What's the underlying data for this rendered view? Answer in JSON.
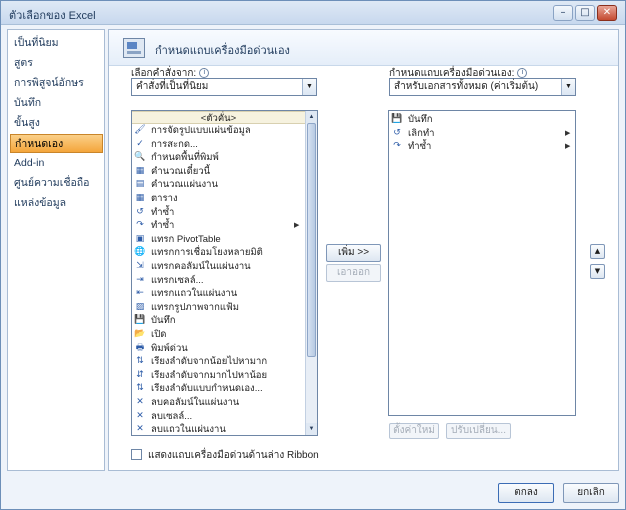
{
  "window": {
    "title": "ตัวเลือกของ Excel",
    "min_symbol": "–",
    "max_symbol": "□",
    "close_symbol": "✕"
  },
  "sidebar": {
    "items": [
      {
        "label": "เป็นที่นิยม"
      },
      {
        "label": "สูตร"
      },
      {
        "label": "การพิสูจน์อักษร"
      },
      {
        "label": "บันทึก"
      },
      {
        "label": "ขั้นสูง"
      },
      {
        "label": "กำหนดเอง",
        "active": true
      },
      {
        "label": "Add-in"
      },
      {
        "label": "ศูนย์ความเชื่อถือ"
      },
      {
        "label": "แหล่งข้อมูล"
      }
    ]
  },
  "header": {
    "title": "กำหนดแถบเครื่องมือด่วนเอง"
  },
  "left": {
    "label": "เลือกคำสั่งจาก:",
    "combo_value": "คำสั่งที่เป็นที่นิยม",
    "separator_item": "<ตัวคั่น>",
    "commands": [
      {
        "icon": "format-painter-icon",
        "glyph": "🖌",
        "label": "การจัดรูปแบบแผ่นข้อมูล"
      },
      {
        "icon": "spelling-icon",
        "glyph": "✓",
        "label": "การสะกด..."
      },
      {
        "icon": "print-preview-icon",
        "glyph": "🔍",
        "label": "กำหนดพื้นที่พิมพ์"
      },
      {
        "icon": "calc-icon",
        "glyph": "▦",
        "label": "คำนวณเดี๋ยวนี้"
      },
      {
        "icon": "calc-sheet-icon",
        "glyph": "▤",
        "label": "คำนวณแผ่นงาน"
      },
      {
        "icon": "table-icon",
        "glyph": "▦",
        "label": "ตาราง"
      },
      {
        "icon": "undo-icon",
        "glyph": "↺",
        "label": "ทำซ้ำ"
      },
      {
        "icon": "redo-icon",
        "glyph": "↷",
        "label": "ทำซ้ำ",
        "submenu": true
      },
      {
        "icon": "pivot-table-icon",
        "glyph": "▣",
        "label": "แทรก PivotTable"
      },
      {
        "icon": "hyperlink-icon",
        "glyph": "🌐",
        "label": "แทรกการเชื่อมโยงหลายมิติ"
      },
      {
        "icon": "insert-column-icon",
        "glyph": "⇲",
        "label": "แทรกคอลัมน์ในแผ่นงาน"
      },
      {
        "icon": "insert-cells-icon",
        "glyph": "⇥",
        "label": "แทรกเซลล์..."
      },
      {
        "icon": "insert-row-icon",
        "glyph": "⇤",
        "label": "แทรกแถวในแผ่นงาน"
      },
      {
        "icon": "insert-picture-icon",
        "glyph": "▨",
        "label": "แทรกรูปภาพจากแฟ้ม"
      },
      {
        "icon": "save-icon",
        "glyph": "💾",
        "label": "บันทึก"
      },
      {
        "icon": "open-icon",
        "glyph": "📂",
        "label": "เปิด"
      },
      {
        "icon": "quick-print-icon",
        "glyph": "🖶",
        "label": "พิมพ์ด่วน"
      },
      {
        "icon": "sort-asc-icon",
        "glyph": "⇅",
        "label": "เรียงลำดับจากน้อยไปหามาก"
      },
      {
        "icon": "sort-desc-icon",
        "glyph": "⇵",
        "label": "เรียงลำดับจากมากไปหาน้อย"
      },
      {
        "icon": "custom-sort-icon",
        "glyph": "⇅",
        "label": "เรียงลำดับแบบกำหนดเอง..."
      },
      {
        "icon": "delete-column-icon",
        "glyph": "✕",
        "label": "ลบคอลัมน์ในแผ่นงาน"
      },
      {
        "icon": "delete-cells-icon",
        "glyph": "✕",
        "label": "ลบเซลล์..."
      },
      {
        "icon": "delete-row-icon",
        "glyph": "✕",
        "label": "ลบแถวในแผ่นงาน"
      }
    ]
  },
  "middle": {
    "add_label": "เพิ่ม >>",
    "remove_label": "เอาออก"
  },
  "right": {
    "label": "กำหนดแถบเครื่องมือด่วนเอง:",
    "combo_value": "สำหรับเอกสารทั้งหมด (ค่าเริ่มต้น)",
    "items": [
      {
        "icon": "save-icon",
        "glyph": "💾",
        "label": "บันทึก"
      },
      {
        "icon": "undo-icon",
        "glyph": "↺",
        "label": "เลิกทำ",
        "submenu": true
      },
      {
        "icon": "redo-icon",
        "glyph": "↷",
        "label": "ทำซ้ำ",
        "submenu": true
      }
    ],
    "reset_label": "ตั้งค่าใหม่",
    "modify_label": "ปรับเปลี่ยน..."
  },
  "footer": {
    "checkbox_label": "แสดงแถบเครื่องมือด่วนด้านล่าง Ribbon",
    "ok_label": "ตกลง",
    "cancel_label": "ยกเลิก"
  },
  "colors": {
    "accent": "#f4a53b",
    "border": "#6e86a6"
  }
}
